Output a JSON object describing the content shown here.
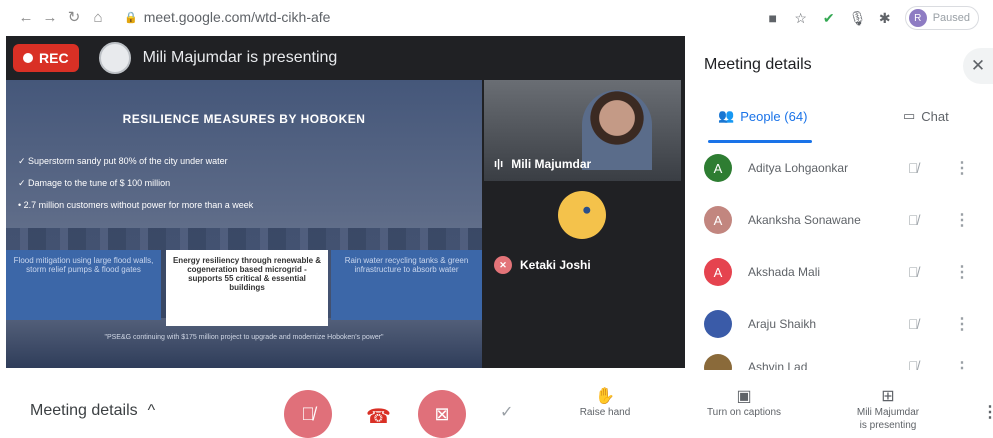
{
  "browser": {
    "url": "meet.google.com/wtd-cikh-afe",
    "profile_label": "Paused",
    "profile_initial": "R"
  },
  "stage": {
    "rec_label": "REC",
    "presenting_text": "Mili Majumdar is presenting",
    "slide": {
      "title": "RESILIENCE MEASURES BY HOBOKEN",
      "bullets": [
        "✓  Superstorm sandy put 80% of the city under water",
        "✓  Damage to the tune of $ 100 million",
        "•  2.7 million customers without power for more than a week"
      ],
      "boxes": [
        "Flood mitigation using large flood walls, storm relief pumps & flood gates",
        "Energy resiliency through renewable & cogeneration based microgrid - supports 55 critical & essential buildings",
        "Rain water recycling tanks & green infrastructure to absorb water"
      ],
      "footer": "\"PSE&G continuing with $175 million project to upgrade and modernize Hoboken's power\""
    },
    "tiles": [
      {
        "name": "Mili Majumdar"
      },
      {
        "name": "Ketaki Joshi"
      }
    ]
  },
  "side_panel": {
    "title": "Meeting details",
    "tabs": {
      "people": "People (64)",
      "chat": "Chat"
    },
    "people": [
      {
        "initial": "A",
        "name": "Aditya Lohgaonkar",
        "color": "#2e7d32"
      },
      {
        "initial": "A",
        "name": "Akanksha Sonawane",
        "color": "#c2867f"
      },
      {
        "initial": "A",
        "name": "Akshada Mali",
        "color": "#e5434f"
      },
      {
        "initial": "",
        "name": "Araju Shaikh",
        "color": "#3a5ba8"
      },
      {
        "initial": "",
        "name": "Ashvin Lad",
        "color": "#8a6a3a"
      }
    ]
  },
  "bottom_bar": {
    "meeting_details": "Meeting details",
    "raise_hand": "Raise hand",
    "captions": "Turn on captions",
    "presenting_line1": "Mili Majumdar",
    "presenting_line2": "is presenting"
  }
}
